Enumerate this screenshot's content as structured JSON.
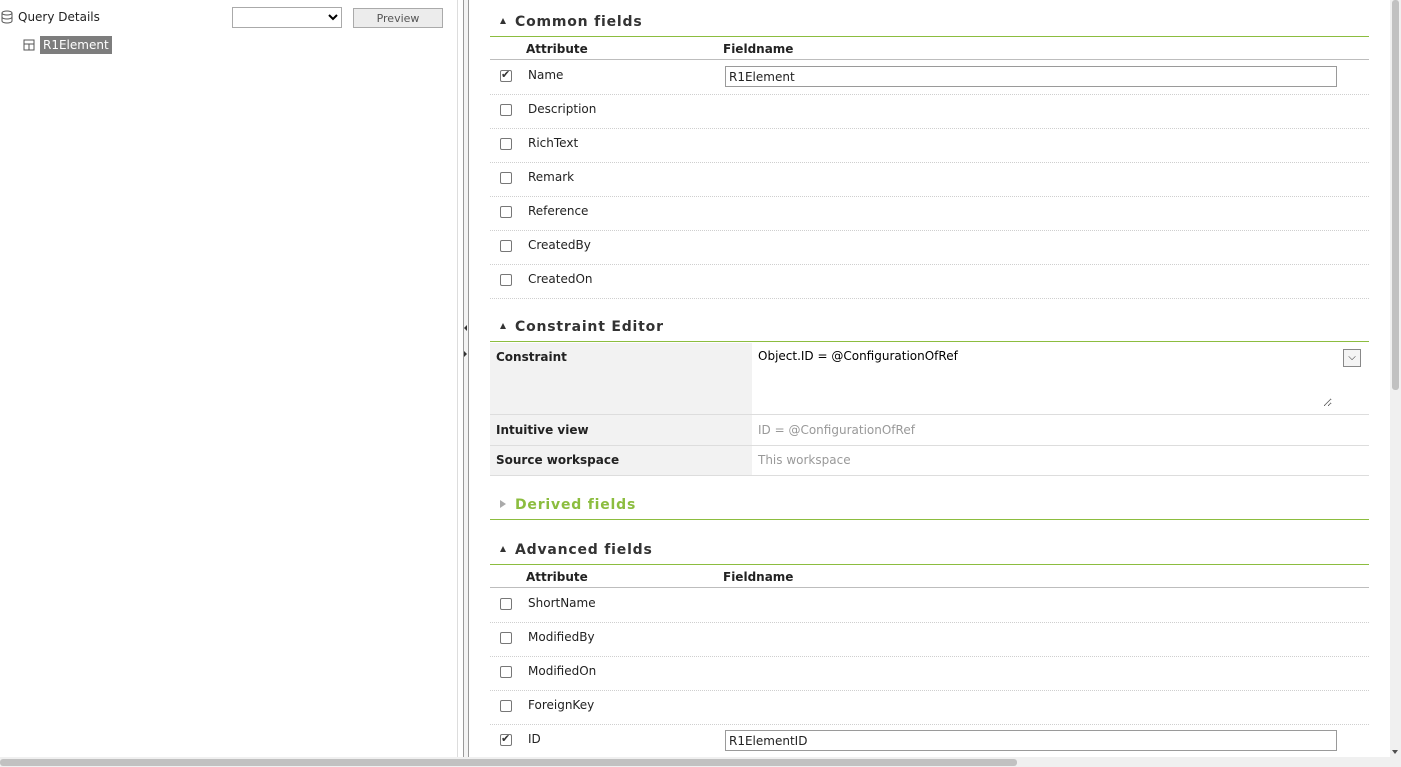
{
  "tree": {
    "root_label": "Query Details",
    "child_label": "R1Element",
    "select_value": "",
    "preview_label": "Preview"
  },
  "common_fields": {
    "title": "Common fields",
    "col_attribute": "Attribute",
    "col_fieldname": "Fieldname",
    "rows": [
      {
        "attr": "Name",
        "checked": true,
        "fieldname": "R1Element"
      },
      {
        "attr": "Description",
        "checked": false
      },
      {
        "attr": "RichText",
        "checked": false
      },
      {
        "attr": "Remark",
        "checked": false
      },
      {
        "attr": "Reference",
        "checked": false
      },
      {
        "attr": "CreatedBy",
        "checked": false
      },
      {
        "attr": "CreatedOn",
        "checked": false
      }
    ]
  },
  "constraint_editor": {
    "title": "Constraint Editor",
    "constraint_label": "Constraint",
    "constraint_value": "Object.ID = @ConfigurationOfRef",
    "intuitive_label": "Intuitive view",
    "intuitive_value": "ID = @ConfigurationOfRef",
    "source_label": "Source workspace",
    "source_value": "This workspace"
  },
  "derived_fields": {
    "title": "Derived fields"
  },
  "advanced_fields": {
    "title": "Advanced fields",
    "col_attribute": "Attribute",
    "col_fieldname": "Fieldname",
    "rows": [
      {
        "attr": "ShortName",
        "checked": false
      },
      {
        "attr": "ModifiedBy",
        "checked": false
      },
      {
        "attr": "ModifiedOn",
        "checked": false
      },
      {
        "attr": "ForeignKey",
        "checked": false
      },
      {
        "attr": "ID",
        "checked": true,
        "fieldname": "R1ElementID"
      }
    ]
  },
  "colors": {
    "accent_green": "#8cbd3f",
    "selected_node_bg": "#7d7d7d"
  }
}
